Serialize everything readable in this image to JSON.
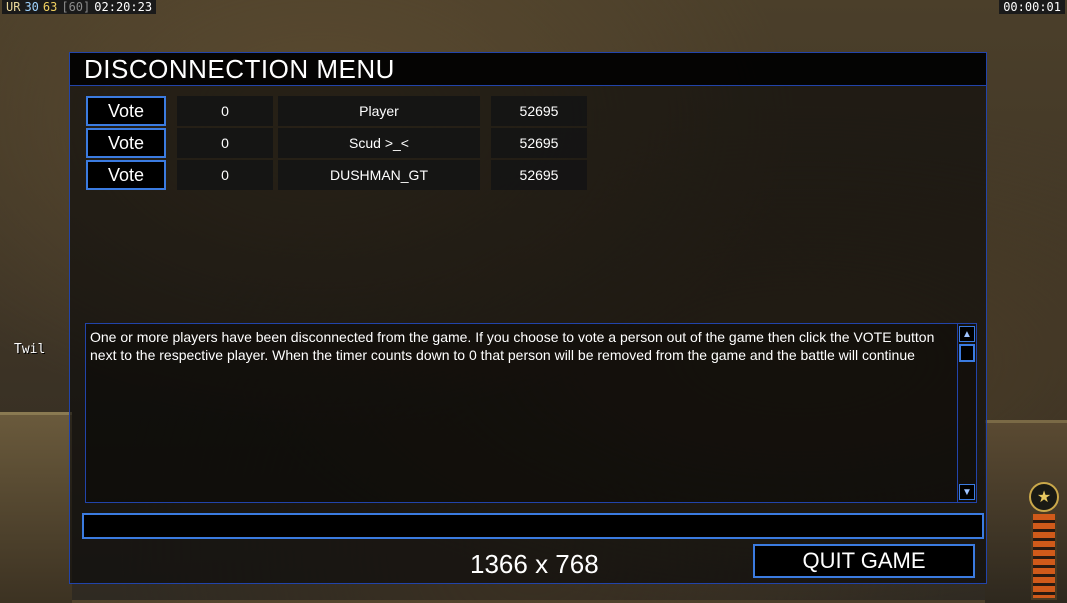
{
  "hud": {
    "prefix": "UR",
    "value1": "30",
    "value2": "63",
    "value3": "[60]",
    "clock": "02:20:23",
    "timer": "00:00:01"
  },
  "side_label": "Twil",
  "dialog": {
    "title": "DISCONNECTION MENU",
    "players": [
      {
        "vote_label": "Vote",
        "count": "0",
        "name": "Player",
        "ping": "52695"
      },
      {
        "vote_label": "Vote",
        "count": "0",
        "name": "Scud >_<",
        "ping": "52695"
      },
      {
        "vote_label": "Vote",
        "count": "0",
        "name": "DUSHMAN_GT",
        "ping": "52695"
      }
    ],
    "message": "One or more players have been disconnected from the game. If you choose to vote a person out of the game then click the VOTE button next to the respective player. When the timer counts down to 0 that person will be removed from the game and the battle will continue",
    "chat_value": "",
    "quit_label": "QUIT GAME",
    "resolution": "1366 x 768"
  },
  "colors": {
    "accent": "#3b7be0",
    "border": "#2244aa",
    "text": "#ffffff"
  }
}
